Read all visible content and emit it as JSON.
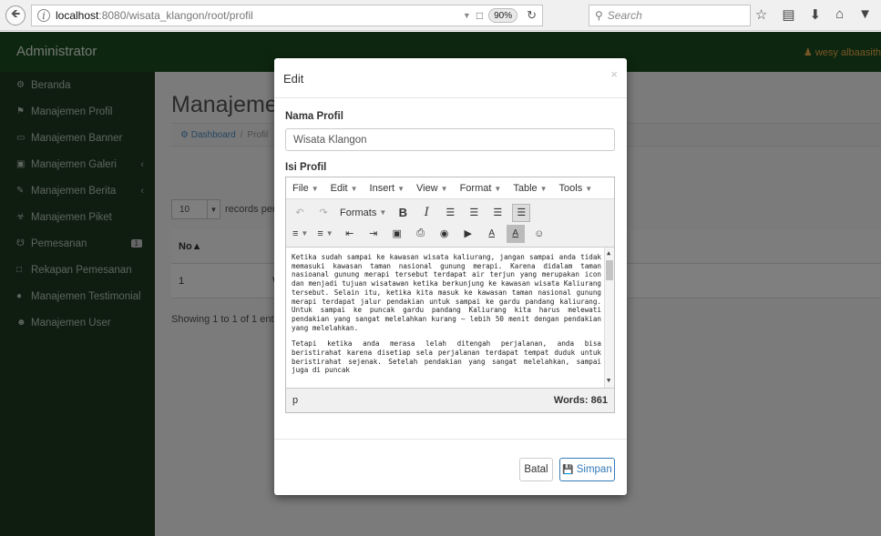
{
  "browser": {
    "url_host": "localhost",
    "url_path": ":8080/wisata_klangon/root/profil",
    "zoom": "90%",
    "search_placeholder": "Search"
  },
  "header": {
    "brand": "Administrator",
    "user": "wesy albaasith"
  },
  "sidebar": {
    "items": [
      {
        "label": "Beranda",
        "icon": "dashboard-icon"
      },
      {
        "label": "Manajemen Profil",
        "icon": "flag-icon"
      },
      {
        "label": "Manajemen Banner",
        "icon": "desktop-icon"
      },
      {
        "label": "Manajemen Galeri",
        "icon": "image-icon",
        "has_caret": true
      },
      {
        "label": "Manajemen Berita",
        "icon": "pencil-icon",
        "has_caret": true
      },
      {
        "label": "Manajemen Piket",
        "icon": "group-icon"
      },
      {
        "label": "Pemesanan",
        "icon": "cart-icon",
        "badge": "1"
      },
      {
        "label": "Rekapan Pemesanan",
        "icon": "file-icon"
      },
      {
        "label": "Manajemen Testimonial",
        "icon": "comments-icon"
      },
      {
        "label": "Manajemen User",
        "icon": "users-icon"
      }
    ]
  },
  "page": {
    "title": "Manajemen",
    "breadcrumb_home": "Dashboard",
    "breadcrumb_current": "Profil",
    "length_value": "10",
    "length_label": "records per pag",
    "table_header_no": "No",
    "row_no": "1",
    "row_name_fragment": "Wi",
    "showing": "Showing 1 to 1 of 1 entries"
  },
  "modal": {
    "title": "Edit",
    "close": "×",
    "nama_label": "Nama Profil",
    "nama_value": "Wisata Klangon",
    "isi_label": "Isi Profil",
    "menu": [
      "File",
      "Edit",
      "Insert",
      "View",
      "Format",
      "Table",
      "Tools"
    ],
    "formats_label": "Formats",
    "paragraph_1": "Ketika sudah sampai ke kawasan wisata kaliurang, jangan sampai anda tidak memasuki kawasan taman nasional gunung merapi. Karena didalam taman nasioanal gunung merapi tersebut terdapat air terjun yang merupakan icon dan menjadi tujuan wisatawan ketika berkunjung ke kawasan wisata Kaliurang tersebut. Selain itu, ketika kita masuk ke kawasan taman nasional gunung merapi terdapat jalur pendakian untuk sampai ke gardu pandang kaliurang. Untuk sampai ke puncak gardu pandang Kaliurang kita harus melewati pendakian yang sangat melelahkan kurang – lebih 50 menit dengan pendakian yang melelahkan.",
    "paragraph_2": "Tetapi ketika anda merasa lelah ditengah perjalanan, anda bisa beristirahat karena disetiap sela perjalanan terdapat tempat duduk untuk beristirahat sejenak. Setelah pendakian yang sangat melelahkan, sampai juga di puncak",
    "status_path": "p",
    "word_count": "Words: 861",
    "batal_label": "Batal",
    "simpan_label": "Simpan"
  }
}
